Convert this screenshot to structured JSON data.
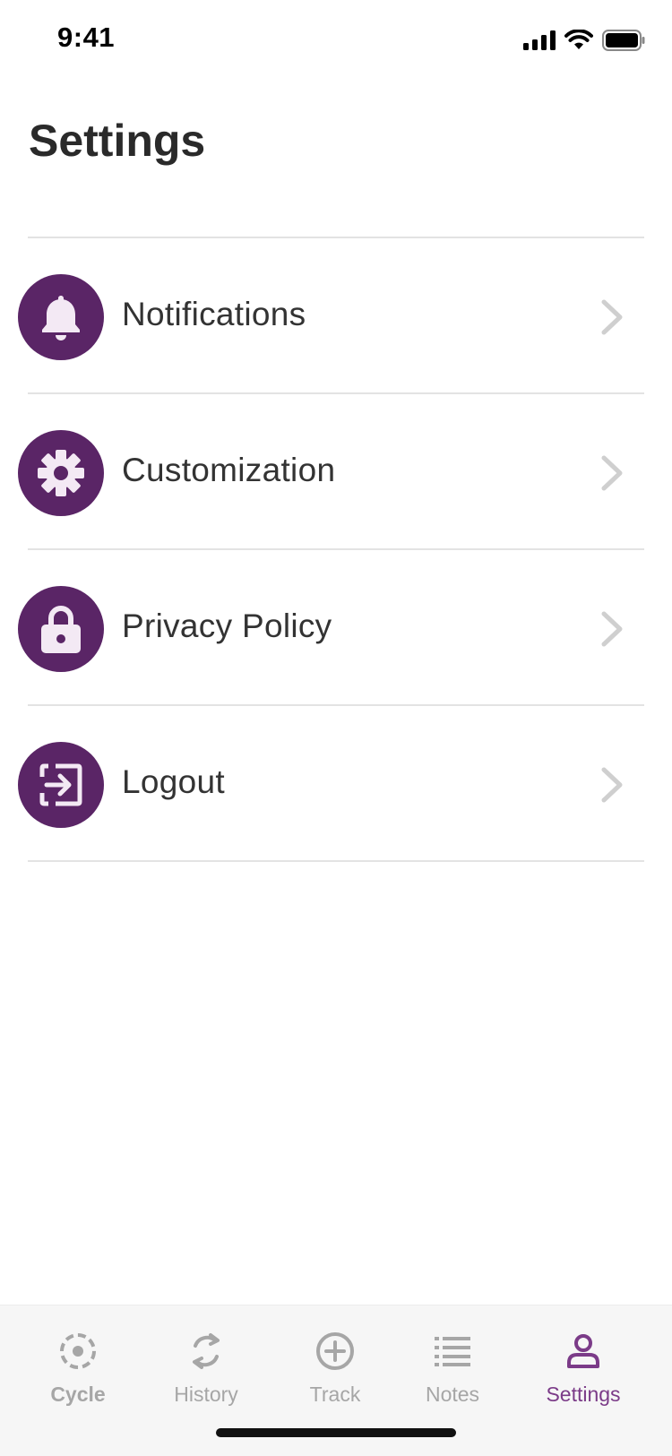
{
  "status_bar": {
    "time": "9:41"
  },
  "header": {
    "title": "Settings"
  },
  "settings": {
    "items": [
      {
        "label": "Notifications",
        "icon": "bell-icon"
      },
      {
        "label": "Customization",
        "icon": "gear-icon"
      },
      {
        "label": "Privacy Policy",
        "icon": "lock-icon"
      },
      {
        "label": "Logout",
        "icon": "logout-icon"
      }
    ]
  },
  "tab_bar": {
    "tabs": [
      {
        "label": "Cycle",
        "icon": "cycle-icon",
        "active": false
      },
      {
        "label": "History",
        "icon": "history-icon",
        "active": false
      },
      {
        "label": "Track",
        "icon": "add-circle-icon",
        "active": false
      },
      {
        "label": "Notes",
        "icon": "list-icon",
        "active": false
      },
      {
        "label": "Settings",
        "icon": "person-icon",
        "active": true
      }
    ]
  },
  "colors": {
    "accent": "#5a2566",
    "active_tab": "#7b3b88",
    "inactive_tab": "#a6a6a6",
    "icon_fill": "#f3e9f4"
  }
}
